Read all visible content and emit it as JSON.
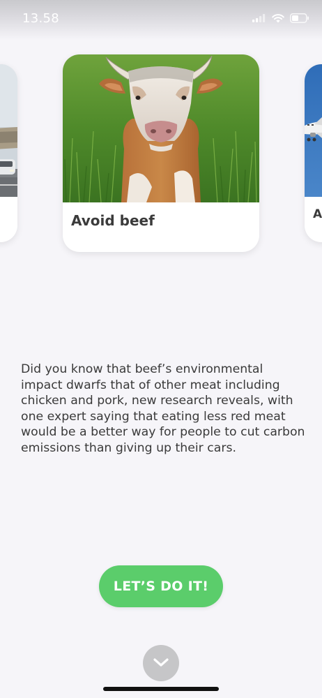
{
  "status_bar": {
    "time": "13.58",
    "icons": [
      "signal-icon",
      "wifi-icon",
      "battery-icon"
    ]
  },
  "carousel": {
    "cards": [
      {
        "title": "",
        "image": "road-cars-image"
      },
      {
        "title": "Avoid beef",
        "image": "cow-image"
      },
      {
        "title": "A",
        "image": "airplane-image"
      }
    ]
  },
  "description": "Did you know that beef’s environmental impact dwarfs that of other meat including chicken and pork, new research reveals, with one expert saying that eating less red meat would be a better way for people to cut carbon emissions than giving up their cars.",
  "cta": {
    "label": "LET’S DO IT!"
  },
  "scroll_down": {
    "icon": "chevron-down-icon"
  },
  "colors": {
    "background": "#f6f5f9",
    "cta": "#5bcd6b",
    "text": "#3a3a3a",
    "scroll_button": "#c6c6c8"
  }
}
